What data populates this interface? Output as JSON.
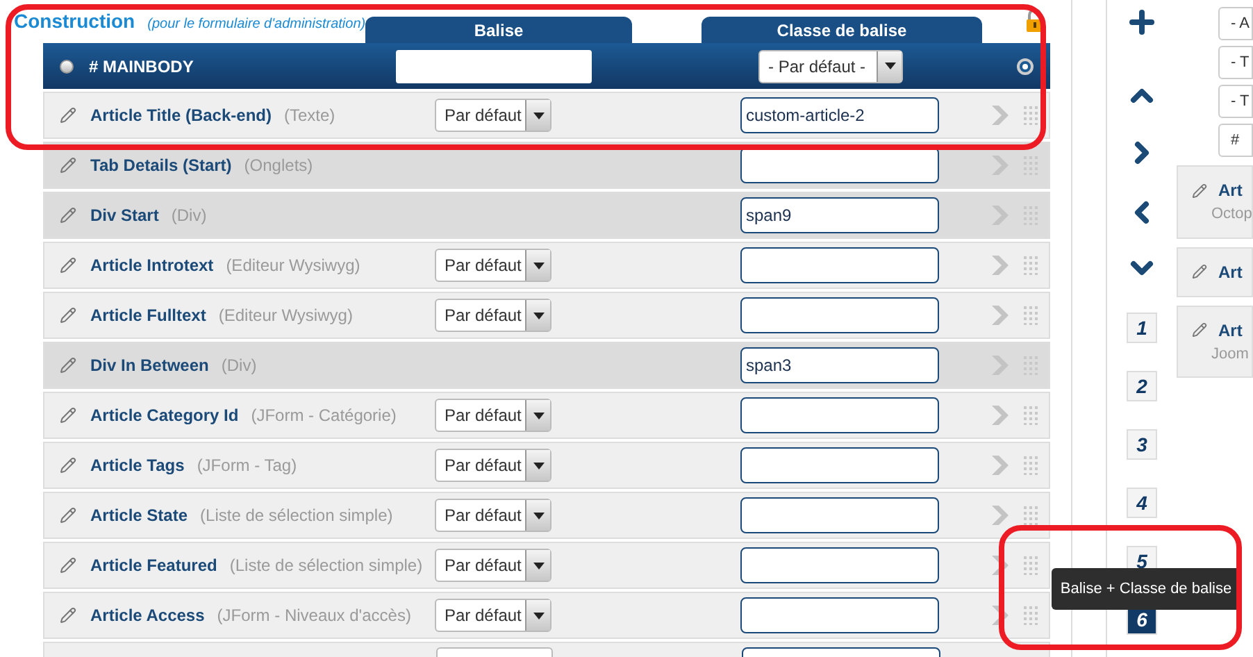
{
  "section": {
    "title": "Construction",
    "subtitle": "(pour le formulaire d'administration)"
  },
  "columns": [
    {
      "label": "Balise"
    },
    {
      "label": "Classe de balise"
    }
  ],
  "header_row": {
    "label": "# MAINBODY",
    "class_select": "- Par défaut -"
  },
  "rows": [
    {
      "kind": "field",
      "name": "Article Title (Back-end)",
      "type": "(Texte)",
      "tag": "Par défaut",
      "class": "custom-article-2"
    },
    {
      "kind": "group",
      "name": "Tab Details (Start)",
      "type": "(Onglets)"
    },
    {
      "kind": "group",
      "name": "Div Start",
      "type": "(Div)",
      "class": "span9"
    },
    {
      "kind": "field",
      "name": "Article Introtext",
      "type": "(Editeur Wysiwyg)",
      "tag": "Par défaut"
    },
    {
      "kind": "field",
      "name": "Article Fulltext",
      "type": "(Editeur Wysiwyg)",
      "tag": "Par défaut"
    },
    {
      "kind": "group",
      "name": "Div In Between",
      "type": "(Div)",
      "class": "span3"
    },
    {
      "kind": "field",
      "name": "Article Category Id",
      "type": "(JForm - Catégorie)",
      "tag": "Par défaut"
    },
    {
      "kind": "field",
      "name": "Article Tags",
      "type": "(JForm - Tag)",
      "tag": "Par défaut"
    },
    {
      "kind": "field",
      "name": "Article State",
      "type": "(Liste de sélection simple)",
      "tag": "Par défaut"
    },
    {
      "kind": "field",
      "name": "Article Featured",
      "type": "(Liste de sélection simple)",
      "tag": "Par défaut"
    },
    {
      "kind": "field",
      "name": "Article Access",
      "type": "(JForm - Niveaux d'accès)",
      "tag": "Par défaut"
    },
    {
      "kind": "cut"
    }
  ],
  "layout_buttons": [
    {
      "label": "1",
      "selected": false
    },
    {
      "label": "2",
      "selected": false
    },
    {
      "label": "3",
      "selected": false
    },
    {
      "label": "4",
      "selected": false
    },
    {
      "label": "5",
      "selected": false
    },
    {
      "label": "6",
      "selected": true
    }
  ],
  "tooltip": "Balise + Classe de balise",
  "filters": [
    "- A",
    "- T",
    "- T",
    "#"
  ],
  "cards": [
    {
      "title": "Art",
      "subtitle": "Octop"
    },
    {
      "title": "Art"
    },
    {
      "title": "Art",
      "subtitle": "Joom"
    }
  ],
  "highlights": [
    {
      "kind": "frame"
    },
    {
      "kind": "frame"
    }
  ]
}
